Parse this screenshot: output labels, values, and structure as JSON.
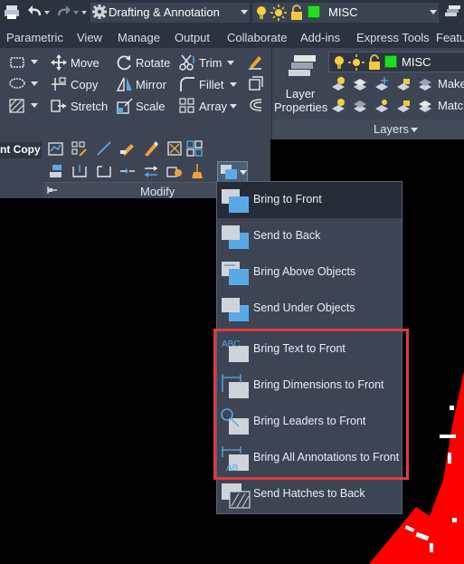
{
  "quick_access": {
    "workspace": "Drafting & Annotation",
    "layer": "MISC"
  },
  "tabs": [
    {
      "label": "Parametric"
    },
    {
      "label": "View"
    },
    {
      "label": "Manage"
    },
    {
      "label": "Output"
    },
    {
      "label": "Collaborate"
    },
    {
      "label": "Add-ins"
    },
    {
      "label": "Express Tools"
    },
    {
      "label": "Featu"
    }
  ],
  "fragment": {
    "label": "nt Copy"
  },
  "modify": {
    "title": "Modify",
    "move": "Move",
    "rotate": "Rotate",
    "trim": "Trim",
    "copy": "Copy",
    "mirror": "Mirror",
    "fillet": "Fillet",
    "stretch": "Stretch",
    "scale": "Scale",
    "array": "Array"
  },
  "layers": {
    "title": "Layers",
    "properties_line1": "Layer",
    "properties_line2": "Properties",
    "current": "MISC",
    "make": "Make",
    "match": "Match"
  },
  "menu": {
    "items": [
      {
        "label": "Bring to Front"
      },
      {
        "label": "Send to Back"
      },
      {
        "label": "Bring Above Objects"
      },
      {
        "label": "Send Under Objects"
      },
      {
        "label": "Bring Text to Front"
      },
      {
        "label": "Bring Dimensions to Front"
      },
      {
        "label": "Bring Leaders to Front"
      },
      {
        "label": "Bring All Annotations to Front"
      },
      {
        "label": "Send Hatches to Back"
      }
    ],
    "icon_text_abc": "ABC",
    "icon_text_ab": "AB"
  },
  "colors": {
    "highlight_border": "#e2393e",
    "drawing_red": "#ff0000",
    "layer_green": "#22dd22",
    "icon_blue": "#5aa9e6"
  }
}
